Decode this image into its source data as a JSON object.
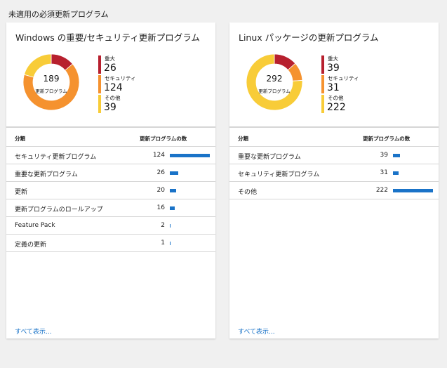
{
  "page_title": "未適用の必須更新プログラム",
  "colors": {
    "critical": "#b7202e",
    "security": "#f5922f",
    "other": "#f8cc38",
    "bar": "#1a73c8"
  },
  "windows": {
    "title": "Windows の重要/セキュリティ更新プログラム",
    "total": "189",
    "total_label": "更新プログラム",
    "legend": [
      {
        "label": "重大",
        "value": "26",
        "color": "#b7202e"
      },
      {
        "label": "セキュリティ",
        "value": "124",
        "color": "#f5922f"
      },
      {
        "label": "その他",
        "value": "39",
        "color": "#f8cc38"
      }
    ],
    "table": {
      "col_category": "分類",
      "col_count": "更新プログラムの数",
      "rows": [
        {
          "label": "セキュリティ更新プログラム",
          "count": "124"
        },
        {
          "label": "重要な更新プログラム",
          "count": "26"
        },
        {
          "label": "更新",
          "count": "20"
        },
        {
          "label": "更新プログラムのロールアップ",
          "count": "16"
        },
        {
          "label": "Feature Pack",
          "count": "2"
        },
        {
          "label": "定義の更新",
          "count": "1"
        }
      ]
    },
    "view_all": "すべて表示..."
  },
  "linux": {
    "title": "Linux パッケージの更新プログラム",
    "total": "292",
    "total_label": "更新プログラム",
    "legend": [
      {
        "label": "重大",
        "value": "39",
        "color": "#b7202e"
      },
      {
        "label": "セキュリティ",
        "value": "31",
        "color": "#f5922f"
      },
      {
        "label": "その他",
        "value": "222",
        "color": "#f8cc38"
      }
    ],
    "table": {
      "col_category": "分類",
      "col_count": "更新プログラムの数",
      "rows": [
        {
          "label": "重要な更新プログラム",
          "count": "39"
        },
        {
          "label": "セキュリティ更新プログラム",
          "count": "31"
        },
        {
          "label": "その他",
          "count": "222"
        }
      ]
    },
    "view_all": "すべて表示..."
  }
}
